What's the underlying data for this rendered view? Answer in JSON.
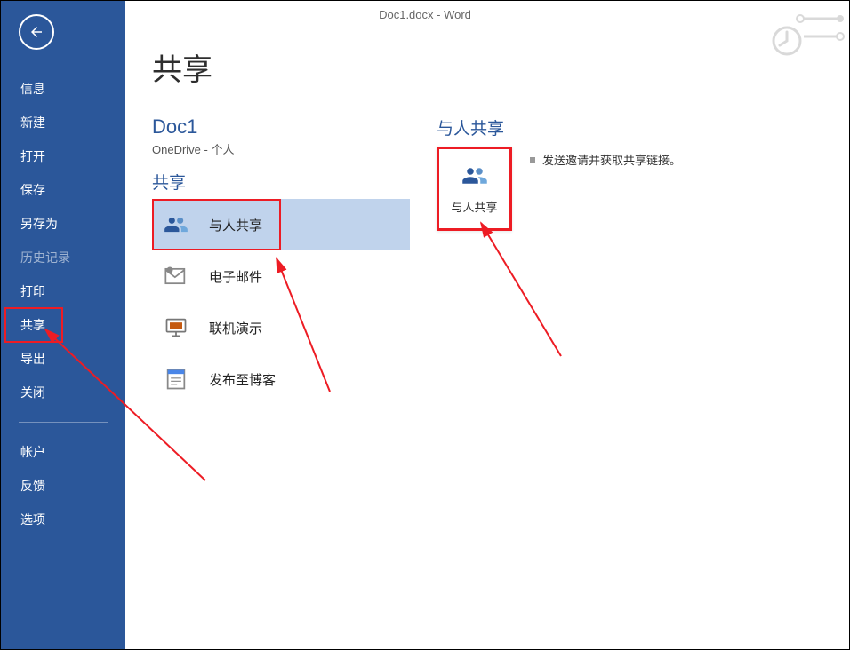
{
  "titlebar": "Doc1.docx  -  Word",
  "sidebar": {
    "items": [
      {
        "label": "信息"
      },
      {
        "label": "新建"
      },
      {
        "label": "打开"
      },
      {
        "label": "保存"
      },
      {
        "label": "另存为"
      },
      {
        "label": "历史记录",
        "disabled": true
      },
      {
        "label": "打印"
      },
      {
        "label": "共享",
        "highlight": true
      },
      {
        "label": "导出"
      },
      {
        "label": "关闭"
      }
    ],
    "bottom": [
      {
        "label": "帐户"
      },
      {
        "label": "反馈"
      },
      {
        "label": "选项"
      }
    ]
  },
  "page": {
    "title": "共享",
    "doc_title": "Doc1",
    "doc_sub": "OneDrive - 个人",
    "section_title": "共享",
    "options": [
      {
        "label": "与人共享",
        "icon": "people"
      },
      {
        "label": "电子邮件",
        "icon": "email"
      },
      {
        "label": "联机演示",
        "icon": "present"
      },
      {
        "label": "发布至博客",
        "icon": "blog"
      }
    ]
  },
  "right": {
    "title": "与人共享",
    "tile_label": "与人共享",
    "desc": "发送邀请并获取共享链接。"
  }
}
